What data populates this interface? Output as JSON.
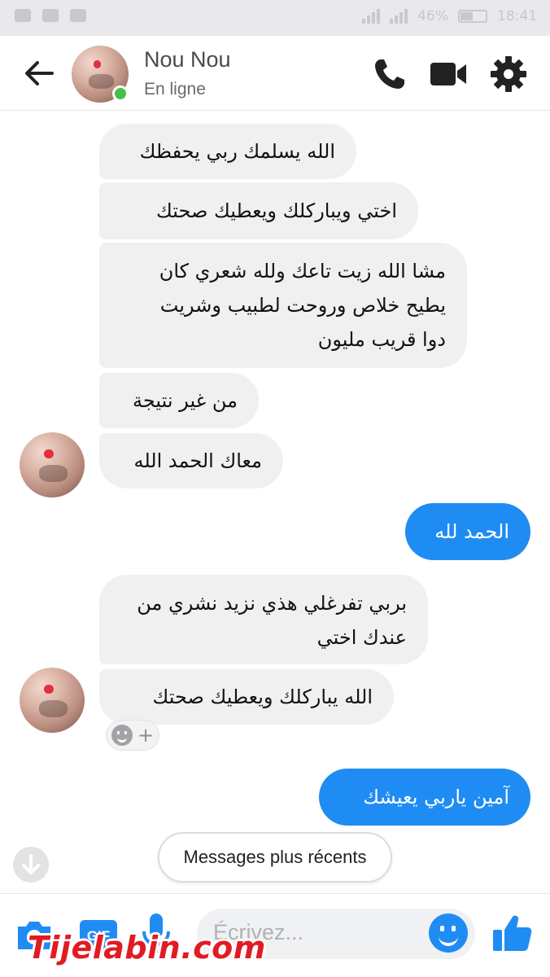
{
  "status_bar": {
    "battery": "46%",
    "time": "18:41"
  },
  "header": {
    "contact_name": "Nou Nou",
    "status": "En ligne",
    "icons": [
      "back-arrow-icon",
      "phone-icon",
      "video-camera-icon",
      "gear-icon"
    ]
  },
  "messages": [
    {
      "sender": "contact",
      "text_lines": [
        "الله يسلمك ربي يحفظك"
      ]
    },
    {
      "sender": "contact",
      "text_lines": [
        "اختي ويباركلك ويعطيك صحتك"
      ]
    },
    {
      "sender": "contact",
      "text_lines": [
        "مشا الله زيت تاعك ولله شعري كان",
        "يطيح خلاص وروحت لطبيب وشريت",
        "دوا قريب مليون"
      ]
    },
    {
      "sender": "contact",
      "text_lines": [
        "من غير نتيجة"
      ]
    },
    {
      "sender": "contact",
      "text_lines": [
        "معاك الحمد الله"
      ]
    },
    {
      "sender": "me",
      "text_lines": [
        "الحمد لله"
      ]
    },
    {
      "sender": "contact",
      "text_lines": [
        "بربي تفرغلي هذي نزيد نشري من",
        "عندك اختي"
      ]
    },
    {
      "sender": "contact",
      "text_lines": [
        "الله يباركلك ويعطيك صحتك"
      ]
    },
    {
      "sender": "me",
      "text_lines": [
        "آمين ياربي يعيشك"
      ]
    }
  ],
  "reaction": {
    "plus": "+"
  },
  "newer_messages_label": "Messages plus récents",
  "composer": {
    "placeholder": "Écrivez...",
    "gif_label": "GIF",
    "icons": [
      "camera-icon",
      "gif-icon",
      "microphone-icon",
      "emoji-icon",
      "thumbs-up-icon"
    ]
  },
  "watermark": "Tijelabin.com",
  "colors": {
    "accent": "#1f8cf3",
    "incoming_bubble": "#f1f0f0",
    "online": "#44c04a",
    "watermark": "#e21b23"
  }
}
